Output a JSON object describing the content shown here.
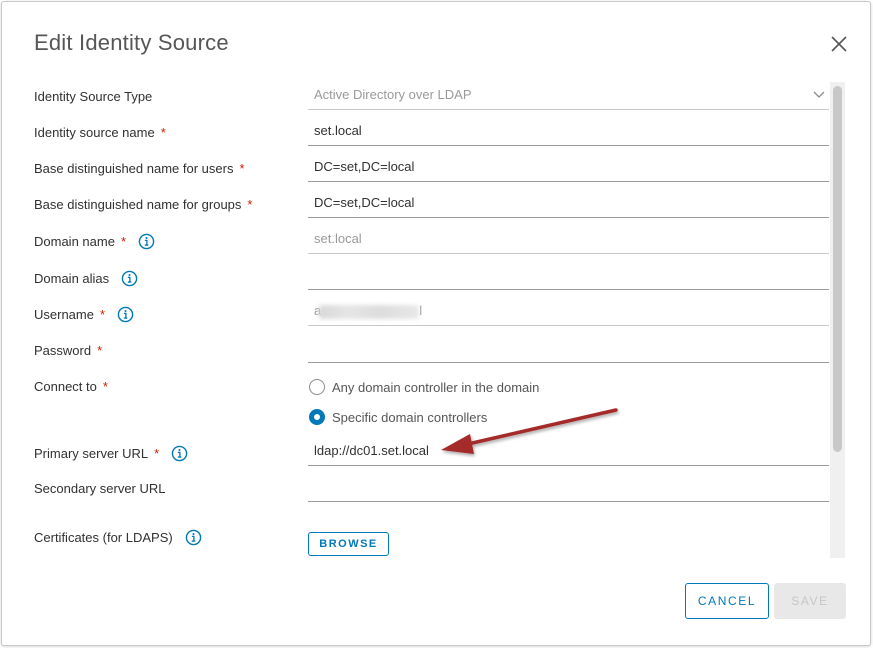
{
  "dialog": {
    "title": "Edit Identity Source",
    "close_icon": "close-icon"
  },
  "form": {
    "identity_source_type": {
      "label": "Identity Source Type",
      "value": "Active Directory over LDAP"
    },
    "identity_source_name": {
      "label": "Identity source name",
      "required": "*",
      "value": "set.local"
    },
    "base_dn_users": {
      "label": "Base distinguished name for users",
      "required": "*",
      "value": "DC=set,DC=local"
    },
    "base_dn_groups": {
      "label": "Base distinguished name for groups",
      "required": "*",
      "value": "DC=set,DC=local"
    },
    "domain_name": {
      "label": "Domain name",
      "required": "*",
      "value": "set.local"
    },
    "domain_alias": {
      "label": "Domain alias",
      "value": ""
    },
    "username": {
      "label": "Username",
      "required": "*",
      "value_start": "a",
      "value_end": "l"
    },
    "password": {
      "label": "Password",
      "required": "*",
      "value": ""
    },
    "connect_to": {
      "label": "Connect to",
      "required": "*",
      "options": [
        "Any domain controller in the domain",
        "Specific domain controllers"
      ],
      "selected": "Specific domain controllers"
    },
    "primary_server_url": {
      "label": "Primary server URL",
      "required": "*",
      "value": "ldap://dc01.set.local"
    },
    "secondary_server_url": {
      "label": "Secondary server URL",
      "value": ""
    },
    "certificates": {
      "label": "Certificates (for LDAPS)",
      "browse_label": "BROWSE"
    }
  },
  "footer": {
    "cancel_label": "CANCEL",
    "save_label": "SAVE"
  },
  "colors": {
    "accent": "#0079b8",
    "required": "#c92100",
    "annotation_arrow": "#a52a2a"
  }
}
